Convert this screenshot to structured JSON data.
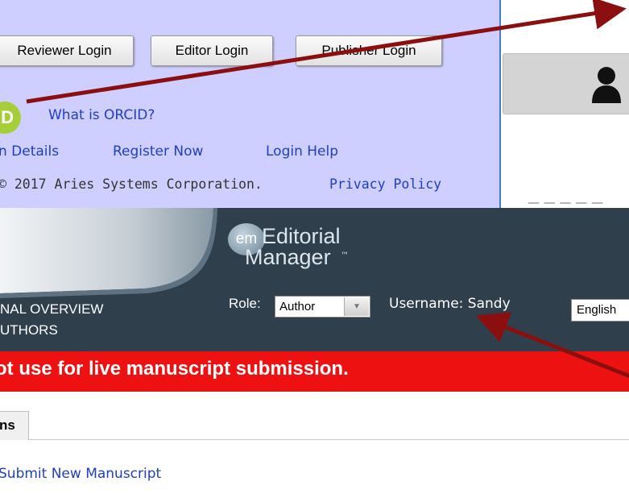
{
  "login_panel": {
    "buttons": {
      "reviewer": "Reviewer Login",
      "editor": "Editor Login",
      "publisher": "Publisher Login"
    },
    "orcid_badge": "iD",
    "what_is_orcid": "What is ORCID?",
    "links": {
      "details": "n Details",
      "register": "Register Now",
      "login_help": "Login Help"
    },
    "copyright": "© 2017 Aries Systems Corporation.",
    "privacy": "Privacy Policy"
  },
  "header": {
    "logo_badge": "em",
    "logo_line1": "Editorial",
    "logo_line2": "Manager",
    "logo_tm": "™",
    "journal_overview": "NAL OVERVIEW",
    "for_authors": "UTHORS",
    "role_label": "Role:",
    "role_value": "Author",
    "username": "Username: Sandy",
    "language": "English"
  },
  "banner": {
    "text": "ot use for live manuscript submission."
  },
  "tabs": {
    "submissions": "ns"
  },
  "actions": {
    "submit_new": "Submit New Manuscript"
  },
  "colors": {
    "panel_bg": "#cfcfff",
    "header_bg": "#2f3f4b",
    "banner_red": "#ed1111",
    "link_blue": "#1f3fbf",
    "arrow_red": "#8b0f0f",
    "orcid_green": "#a6ce39"
  },
  "icons": [
    "person-icon",
    "dropdown-arrow-icon",
    "orcid-icon",
    "annotation-arrow-icon"
  ]
}
